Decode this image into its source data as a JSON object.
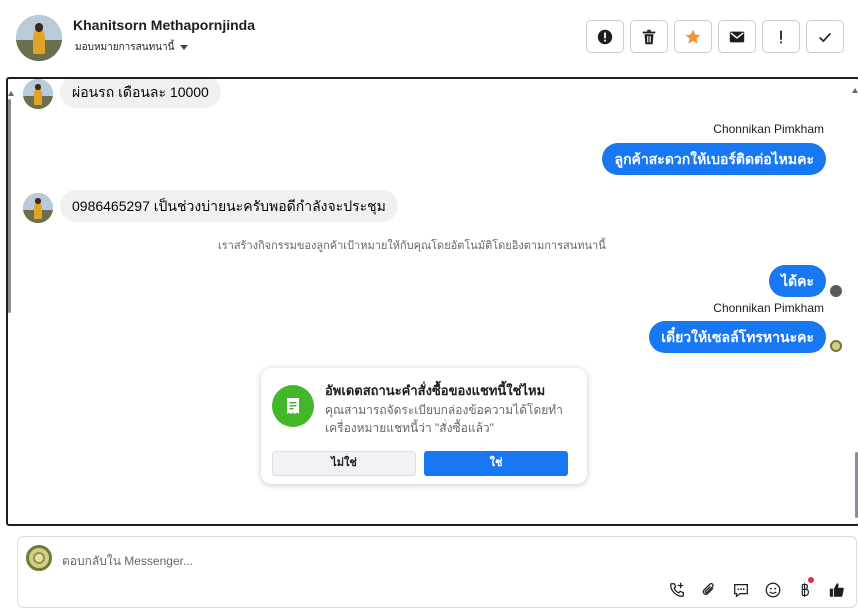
{
  "header": {
    "contact_name": "Khanitsorn Methapornjinda",
    "assign_label": "มอบหมายการสนทนานี้",
    "toolbar": [
      {
        "name": "spam-button",
        "icon": "alert-circle-icon"
      },
      {
        "name": "delete-button",
        "icon": "trash-icon"
      },
      {
        "name": "star-button",
        "icon": "star-icon",
        "color": "#f5923e"
      },
      {
        "name": "mark-unread-button",
        "icon": "envelope-icon"
      },
      {
        "name": "follow-up-button",
        "icon": "exclamation-icon"
      },
      {
        "name": "done-button",
        "icon": "checkmark-icon"
      }
    ]
  },
  "messages": {
    "m1": "ผ่อนรถ เดือนละ 10000",
    "sender1": "Chonnikan Pimkham",
    "m2": "ลูกค้าสะดวกให้เบอร์ติดต่อไหมคะ",
    "m3": "0986465297 เป็นช่วงบ่ายนะครับพอดีกำลังจะประชุม",
    "system_note": "เราสร้างกิจกรรมของลูกค้าเป้าหมายให้กับคุณโดยอัตโนมัติโดยอิงตามการสนทนานี้",
    "m4": "ได้คะ",
    "sender2": "Chonnikan Pimkham",
    "m5": "เดี๋ยวให้เซลล์โทรหานะคะ"
  },
  "order_card": {
    "title": "อัพเดตสถานะคำสั่งซื้อของแชทนี้ใช่ไหม",
    "body": "คุณสามารถจัดระเบียบกล่องข้อความได้โดยทำเครื่องหมายแชทนี้ว่า \"สั่งซื้อแล้ว\"",
    "no_label": "ไม่ใช่",
    "yes_label": "ใช่"
  },
  "composer": {
    "placeholder": "ตอบกลับใน Messenger..."
  },
  "colors": {
    "brand_blue": "#1877f2",
    "success_green": "#42b72a",
    "star_orange": "#f5923e"
  }
}
